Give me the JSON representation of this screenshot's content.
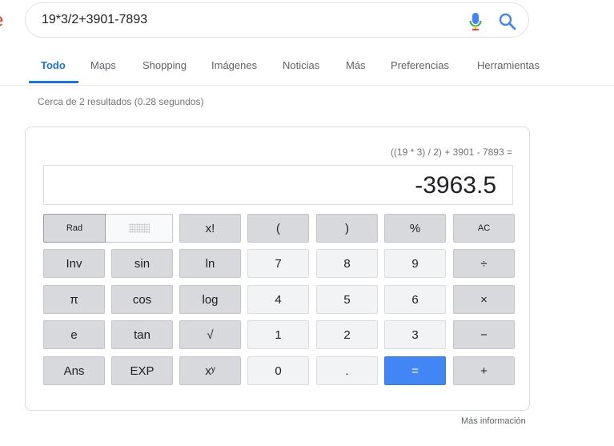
{
  "search": {
    "query": "19*3/2+3901-7893"
  },
  "tabs": [
    {
      "label": "Todo"
    },
    {
      "label": "Maps"
    },
    {
      "label": "Shopping"
    },
    {
      "label": "Imágenes"
    },
    {
      "label": "Noticias"
    },
    {
      "label": "Más"
    },
    {
      "label": "Preferencias"
    },
    {
      "label": "Herramientas"
    }
  ],
  "result_stats": "Cerca de 2 resultados (0.28 segundos)",
  "calculator": {
    "expression": "((19 * 3) / 2) + 3901 - 7893 =",
    "result": "-3963.5",
    "mode": "Rad",
    "keys": {
      "factorial": "x!",
      "lparen": "(",
      "rparen": ")",
      "percent": "%",
      "clear": "AC",
      "inv": "Inv",
      "sin": "sin",
      "ln": "ln",
      "seven": "7",
      "eight": "8",
      "nine": "9",
      "divide": "÷",
      "pi": "π",
      "cos": "cos",
      "log": "log",
      "four": "4",
      "five": "5",
      "six": "6",
      "multiply": "×",
      "e": "e",
      "tan": "tan",
      "sqrt": "√",
      "one": "1",
      "two": "2",
      "three": "3",
      "minus": "−",
      "ans": "Ans",
      "exp": "EXP",
      "power": "xʸ",
      "zero": "0",
      "dot": ".",
      "equals": "=",
      "plus": "+"
    }
  },
  "more_info": "Más información",
  "colors": {
    "accent": "#1a73e8",
    "equals_key": "#4285f4",
    "dark_key": "#d7d9dc",
    "light_key": "#f1f3f4"
  }
}
